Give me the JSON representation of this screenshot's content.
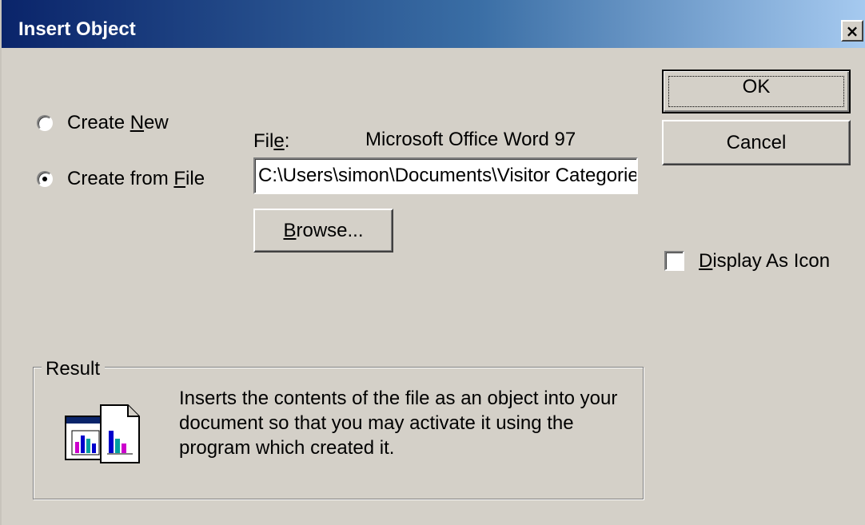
{
  "window": {
    "title": "Insert Object",
    "close_label": "×"
  },
  "options": {
    "create_new": {
      "pre": "Create ",
      "accel": "N",
      "post": "ew",
      "checked": false
    },
    "create_from_file": {
      "pre": "Create from ",
      "accel": "F",
      "post": "ile",
      "checked": true
    }
  },
  "file": {
    "label_pre": "Fil",
    "label_accel": "e",
    "label_post": ":",
    "type": "Microsoft Office Word 97",
    "path": "C:\\Users\\simon\\Documents\\Visitor Categories"
  },
  "buttons": {
    "browse_accel": "B",
    "browse_rest": "rowse...",
    "ok": "OK",
    "cancel": "Cancel"
  },
  "display_as_icon": {
    "accel": "D",
    "rest": "isplay As Icon",
    "checked": false
  },
  "result": {
    "label": "Result",
    "text": "Inserts the contents of the file as an object into your document so that you may activate it using the program which created it."
  }
}
